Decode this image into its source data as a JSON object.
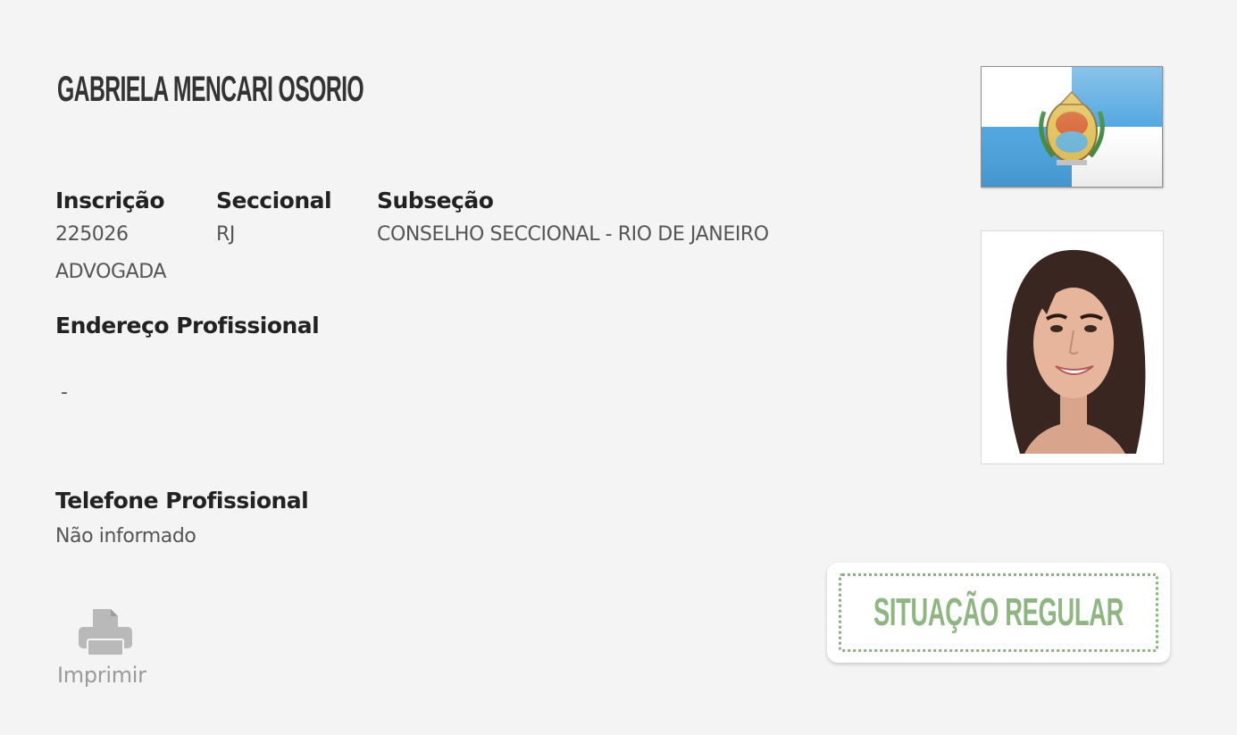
{
  "profile": {
    "name": "GABRIELA MENCARI OSORIO",
    "category": "ADVOGADA"
  },
  "registration": {
    "inscricao_label": "Inscrição",
    "inscricao_value": "225026",
    "seccional_label": "Seccional",
    "seccional_value": "RJ",
    "subsecao_label": "Subseção",
    "subsecao_value": "CONSELHO SECCIONAL - RIO DE JANEIRO"
  },
  "address": {
    "label": "Endereço Profissional",
    "value": "-"
  },
  "phone": {
    "label": "Telefone Profissional",
    "value": "Não informado"
  },
  "actions": {
    "print_label": "Imprimir",
    "print_icon": "printer-icon"
  },
  "status": {
    "text": "SITUAÇÃO REGULAR",
    "color": "#8fb583"
  },
  "colors": {
    "background": "#f4f4f4",
    "flag_blue": "#4aa3df",
    "status_green": "#8ab27e"
  }
}
